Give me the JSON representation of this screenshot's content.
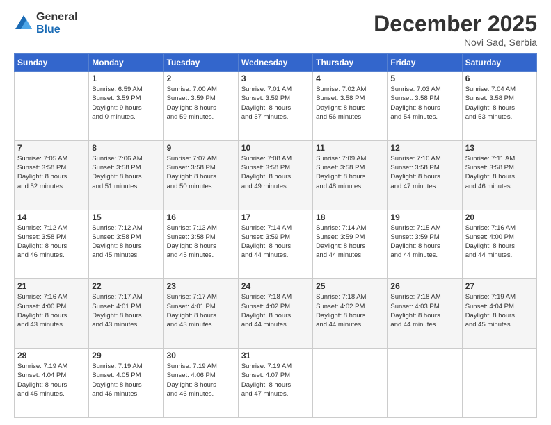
{
  "logo": {
    "general": "General",
    "blue": "Blue"
  },
  "header": {
    "month": "December 2025",
    "location": "Novi Sad, Serbia"
  },
  "weekdays": [
    "Sunday",
    "Monday",
    "Tuesday",
    "Wednesday",
    "Thursday",
    "Friday",
    "Saturday"
  ],
  "weeks": [
    [
      {
        "day": "",
        "info": ""
      },
      {
        "day": "1",
        "info": "Sunrise: 6:59 AM\nSunset: 3:59 PM\nDaylight: 9 hours\nand 0 minutes."
      },
      {
        "day": "2",
        "info": "Sunrise: 7:00 AM\nSunset: 3:59 PM\nDaylight: 8 hours\nand 59 minutes."
      },
      {
        "day": "3",
        "info": "Sunrise: 7:01 AM\nSunset: 3:59 PM\nDaylight: 8 hours\nand 57 minutes."
      },
      {
        "day": "4",
        "info": "Sunrise: 7:02 AM\nSunset: 3:58 PM\nDaylight: 8 hours\nand 56 minutes."
      },
      {
        "day": "5",
        "info": "Sunrise: 7:03 AM\nSunset: 3:58 PM\nDaylight: 8 hours\nand 54 minutes."
      },
      {
        "day": "6",
        "info": "Sunrise: 7:04 AM\nSunset: 3:58 PM\nDaylight: 8 hours\nand 53 minutes."
      }
    ],
    [
      {
        "day": "7",
        "info": "Sunrise: 7:05 AM\nSunset: 3:58 PM\nDaylight: 8 hours\nand 52 minutes."
      },
      {
        "day": "8",
        "info": "Sunrise: 7:06 AM\nSunset: 3:58 PM\nDaylight: 8 hours\nand 51 minutes."
      },
      {
        "day": "9",
        "info": "Sunrise: 7:07 AM\nSunset: 3:58 PM\nDaylight: 8 hours\nand 50 minutes."
      },
      {
        "day": "10",
        "info": "Sunrise: 7:08 AM\nSunset: 3:58 PM\nDaylight: 8 hours\nand 49 minutes."
      },
      {
        "day": "11",
        "info": "Sunrise: 7:09 AM\nSunset: 3:58 PM\nDaylight: 8 hours\nand 48 minutes."
      },
      {
        "day": "12",
        "info": "Sunrise: 7:10 AM\nSunset: 3:58 PM\nDaylight: 8 hours\nand 47 minutes."
      },
      {
        "day": "13",
        "info": "Sunrise: 7:11 AM\nSunset: 3:58 PM\nDaylight: 8 hours\nand 46 minutes."
      }
    ],
    [
      {
        "day": "14",
        "info": "Sunrise: 7:12 AM\nSunset: 3:58 PM\nDaylight: 8 hours\nand 46 minutes."
      },
      {
        "day": "15",
        "info": "Sunrise: 7:12 AM\nSunset: 3:58 PM\nDaylight: 8 hours\nand 45 minutes."
      },
      {
        "day": "16",
        "info": "Sunrise: 7:13 AM\nSunset: 3:58 PM\nDaylight: 8 hours\nand 45 minutes."
      },
      {
        "day": "17",
        "info": "Sunrise: 7:14 AM\nSunset: 3:59 PM\nDaylight: 8 hours\nand 44 minutes."
      },
      {
        "day": "18",
        "info": "Sunrise: 7:14 AM\nSunset: 3:59 PM\nDaylight: 8 hours\nand 44 minutes."
      },
      {
        "day": "19",
        "info": "Sunrise: 7:15 AM\nSunset: 3:59 PM\nDaylight: 8 hours\nand 44 minutes."
      },
      {
        "day": "20",
        "info": "Sunrise: 7:16 AM\nSunset: 4:00 PM\nDaylight: 8 hours\nand 44 minutes."
      }
    ],
    [
      {
        "day": "21",
        "info": "Sunrise: 7:16 AM\nSunset: 4:00 PM\nDaylight: 8 hours\nand 43 minutes."
      },
      {
        "day": "22",
        "info": "Sunrise: 7:17 AM\nSunset: 4:01 PM\nDaylight: 8 hours\nand 43 minutes."
      },
      {
        "day": "23",
        "info": "Sunrise: 7:17 AM\nSunset: 4:01 PM\nDaylight: 8 hours\nand 43 minutes."
      },
      {
        "day": "24",
        "info": "Sunrise: 7:18 AM\nSunset: 4:02 PM\nDaylight: 8 hours\nand 44 minutes."
      },
      {
        "day": "25",
        "info": "Sunrise: 7:18 AM\nSunset: 4:02 PM\nDaylight: 8 hours\nand 44 minutes."
      },
      {
        "day": "26",
        "info": "Sunrise: 7:18 AM\nSunset: 4:03 PM\nDaylight: 8 hours\nand 44 minutes."
      },
      {
        "day": "27",
        "info": "Sunrise: 7:19 AM\nSunset: 4:04 PM\nDaylight: 8 hours\nand 45 minutes."
      }
    ],
    [
      {
        "day": "28",
        "info": "Sunrise: 7:19 AM\nSunset: 4:04 PM\nDaylight: 8 hours\nand 45 minutes."
      },
      {
        "day": "29",
        "info": "Sunrise: 7:19 AM\nSunset: 4:05 PM\nDaylight: 8 hours\nand 46 minutes."
      },
      {
        "day": "30",
        "info": "Sunrise: 7:19 AM\nSunset: 4:06 PM\nDaylight: 8 hours\nand 46 minutes."
      },
      {
        "day": "31",
        "info": "Sunrise: 7:19 AM\nSunset: 4:07 PM\nDaylight: 8 hours\nand 47 minutes."
      },
      {
        "day": "",
        "info": ""
      },
      {
        "day": "",
        "info": ""
      },
      {
        "day": "",
        "info": ""
      }
    ]
  ]
}
